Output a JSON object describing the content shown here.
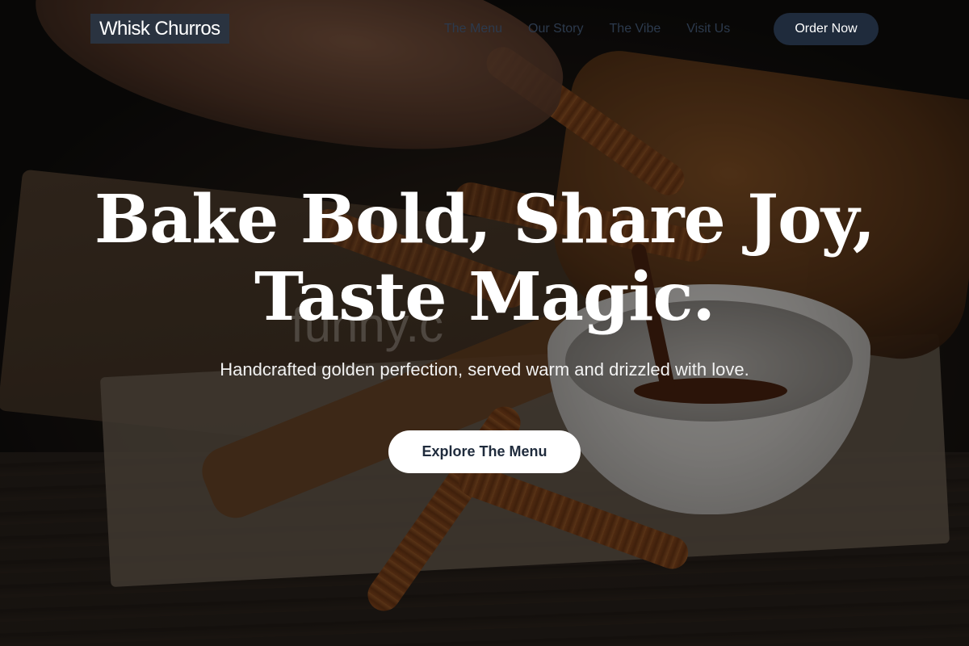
{
  "nav": {
    "logo": "Whisk Churros",
    "links": [
      "The Menu",
      "Our Story",
      "The Vibe",
      "Visit Us"
    ],
    "order_label": "Order Now"
  },
  "hero": {
    "headline_line1": "Bake Bold, Share Joy,",
    "headline_line2": "Taste Magic.",
    "subtitle": "Handcrafted golden perfection, served warm and drizzled with love.",
    "cta_label": "Explore The Menu",
    "watermark": "funny.c"
  },
  "colors": {
    "nav_dark": "#1f2b3c",
    "logo_bg": "#2a3340",
    "white": "#ffffff"
  }
}
